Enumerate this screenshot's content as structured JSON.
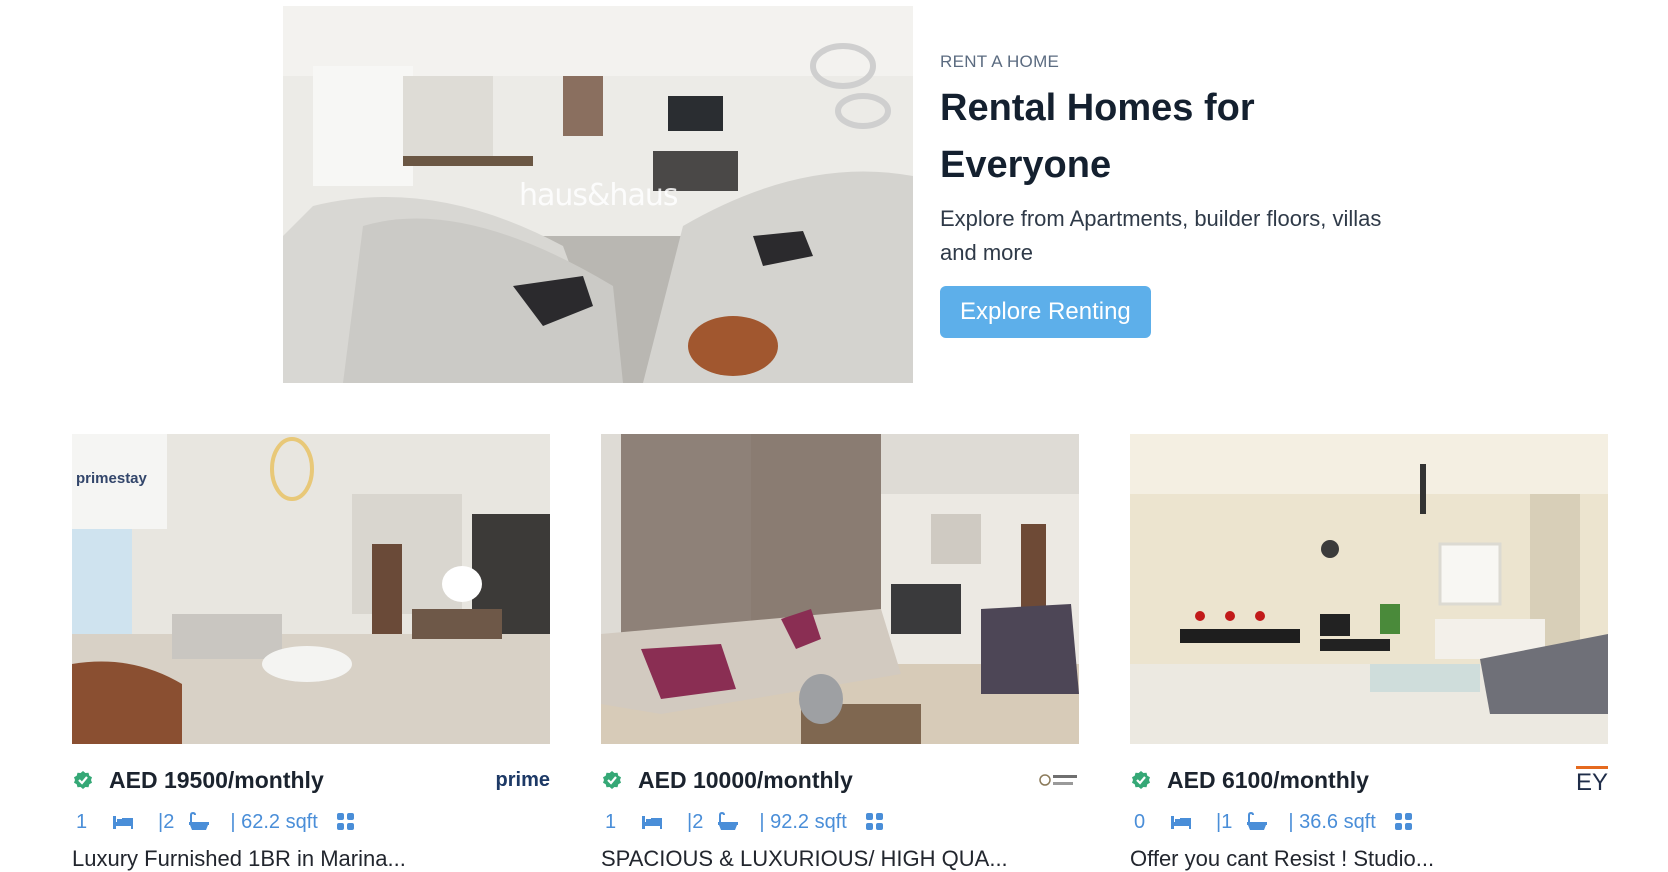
{
  "hero": {
    "watermark": "haus&haus",
    "eyebrow": "RENT A HOME",
    "title": "Rental Homes for Everyone",
    "description": "Explore from Apartments, builder floors, villas and more",
    "cta_label": "Explore Renting"
  },
  "accent_color": "#5dafea",
  "meta_color": "#4a8ed8",
  "verified_color": "#35a876",
  "listings": [
    {
      "price": "AED 19500/monthly",
      "logo_text": "prime",
      "logo_color": "#1d3966",
      "photo_watermark": "primestay",
      "beds": "1",
      "baths": "|2",
      "area": "| 62.2 sqft",
      "title": "Luxury Furnished 1BR in Marina..."
    },
    {
      "price": "AED 10000/monthly",
      "logo_text": "",
      "logo_color": "#8b7a5a",
      "beds": "1",
      "baths": "|2",
      "area": "| 92.2 sqft",
      "title": "SPACIOUS & LUXURIOUS/ HIGH QUA..."
    },
    {
      "price": "AED 6100/monthly",
      "logo_text": "EY",
      "logo_color": "#1f2d49",
      "beds": "0",
      "baths": "|1",
      "area": "| 36.6 sqft",
      "title": "Offer you cant Resist ! Studio..."
    }
  ]
}
